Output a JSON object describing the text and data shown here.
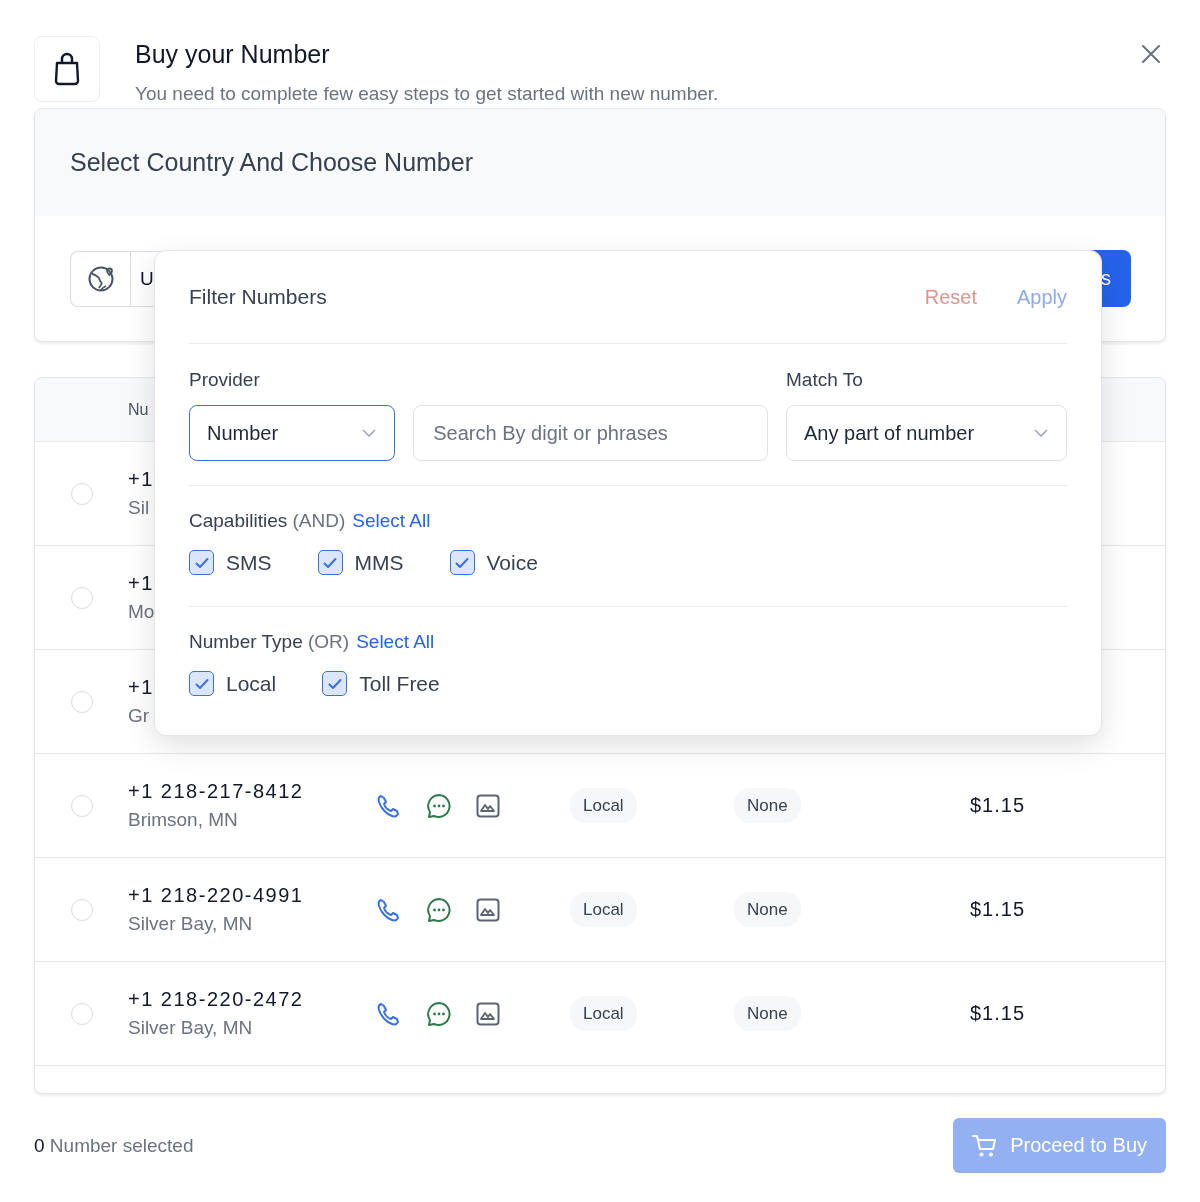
{
  "header": {
    "title": "Buy your Number",
    "subtitle": "You need to complete few easy steps to get started with new number."
  },
  "country_section": {
    "title": "Select Country And Choose Number",
    "country_value": "U",
    "search_button": "s"
  },
  "table": {
    "column_1": "Nu",
    "rows": [
      {
        "selected": false,
        "number": "+1",
        "location": "Sil"
      },
      {
        "selected": false,
        "number": "+1",
        "location": "Mo"
      },
      {
        "selected": false,
        "number": "+1",
        "location": "Gr"
      },
      {
        "selected": false,
        "number": "+1 218-217-8412",
        "location": "Brimson, MN",
        "type": "Local",
        "address": "None",
        "price": "$1.15"
      },
      {
        "selected": false,
        "number": "+1 218-220-4991",
        "location": "Silver Bay, MN",
        "type": "Local",
        "address": "None",
        "price": "$1.15"
      },
      {
        "selected": false,
        "number": "+1 218-220-2472",
        "location": "Silver Bay, MN",
        "type": "Local",
        "address": "None",
        "price": "$1.15"
      }
    ]
  },
  "filter": {
    "title": "Filter Numbers",
    "reset": "Reset",
    "apply": "Apply",
    "provider": {
      "label": "Provider",
      "value": "Number"
    },
    "search": {
      "placeholder": "Search By digit or phrases"
    },
    "match": {
      "label": "Match To",
      "value": "Any part of number"
    },
    "groups": [
      {
        "label": "Capabilities",
        "mode": "(AND)",
        "select_all": "Select All",
        "options": [
          {
            "label": "SMS",
            "checked": true
          },
          {
            "label": "MMS",
            "checked": true
          },
          {
            "label": "Voice",
            "checked": true
          }
        ]
      },
      {
        "label": "Number Type",
        "mode": "(OR)",
        "select_all": "Select All",
        "options": [
          {
            "label": "Local",
            "checked": true
          },
          {
            "label": "Toll Free",
            "checked": true
          }
        ]
      }
    ]
  },
  "footer": {
    "count": "0",
    "count_label": "Number selected",
    "proceed": "Proceed to Buy"
  }
}
